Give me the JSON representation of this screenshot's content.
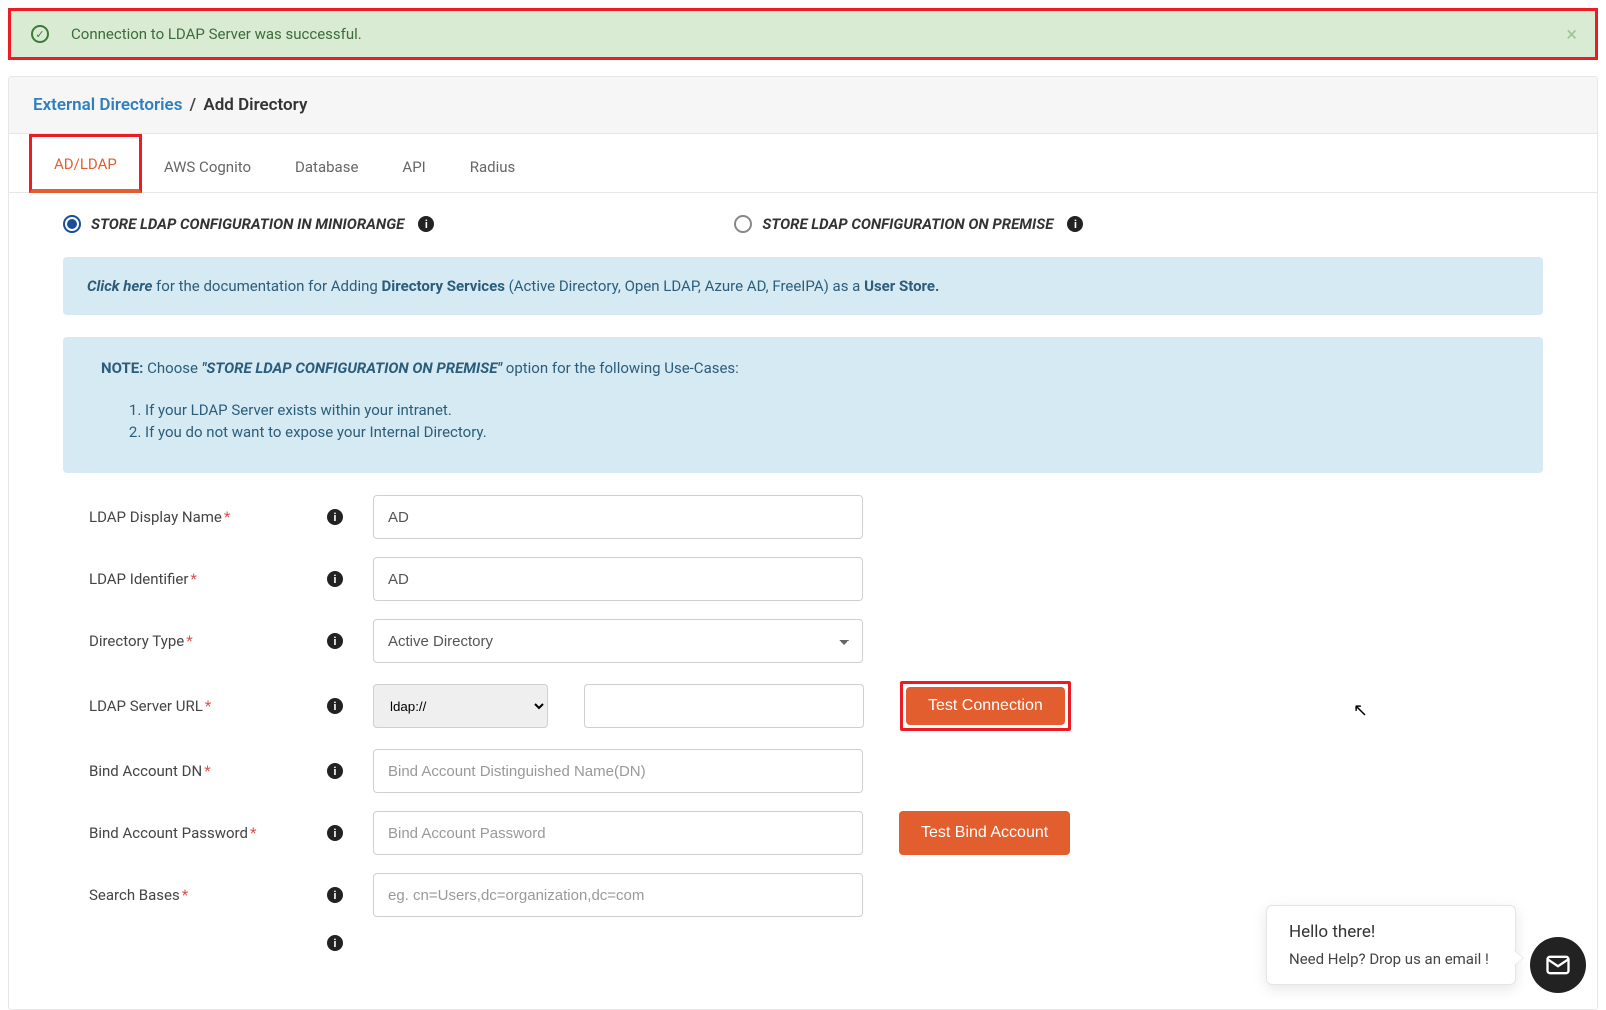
{
  "alert": {
    "message": "Connection to LDAP Server was successful."
  },
  "breadcrumb": {
    "link": "External Directories",
    "sep": "/",
    "current": "Add Directory"
  },
  "tabs": [
    "AD/LDAP",
    "AWS Cognito",
    "Database",
    "API",
    "Radius"
  ],
  "radios": {
    "opt1": "STORE LDAP CONFIGURATION IN MINIORANGE",
    "opt2": "STORE LDAP CONFIGURATION ON PREMISE"
  },
  "doc": {
    "link": "Click here",
    "t1": " for the documentation for Adding ",
    "b1": "Directory Services",
    "t2": " (Active Directory, Open LDAP, Azure AD, FreeIPA) as a ",
    "b2": "User Store."
  },
  "note": {
    "label": "NOTE:",
    "pre": "  Choose ",
    "quote": "\"STORE LDAP CONFIGURATION ON PREMISE\"",
    "post": " option for the following Use-Cases:",
    "li1": "If your LDAP Server exists within your intranet.",
    "li2": "If you do not want to expose your Internal Directory."
  },
  "form": {
    "display_name": {
      "label": "LDAP Display Name",
      "value": "AD"
    },
    "identifier": {
      "label": "LDAP Identifier",
      "value": "AD"
    },
    "dir_type": {
      "label": "Directory Type",
      "value": "Active Directory"
    },
    "server_url": {
      "label": "LDAP Server URL",
      "proto": "ldap://"
    },
    "bind_dn": {
      "label": "Bind Account DN",
      "placeholder": "Bind Account Distinguished Name(DN)"
    },
    "bind_pw": {
      "label": "Bind Account Password",
      "placeholder": "Bind Account Password"
    },
    "search_bases": {
      "label": "Search Bases",
      "placeholder": "eg. cn=Users,dc=organization,dc=com"
    }
  },
  "buttons": {
    "test_conn": "Test Connection",
    "test_bind": "Test Bind Account"
  },
  "chat": {
    "line1": "Hello there!",
    "line2": "Need Help? Drop us an email !"
  }
}
